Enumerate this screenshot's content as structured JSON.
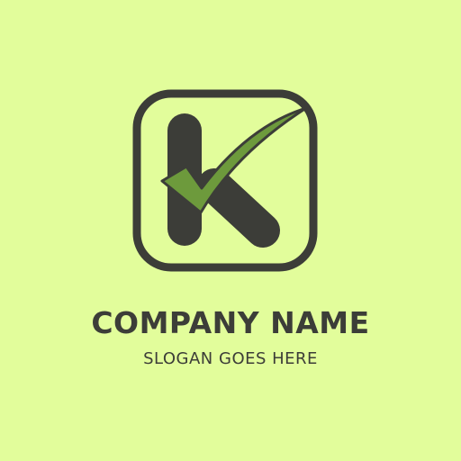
{
  "brand": {
    "name": "COMPANY NAME",
    "slogan": "SLOGAN GOES HERE"
  },
  "logo": {
    "icon": "letter-k-with-checkmark-icon",
    "letter": "K"
  },
  "colors": {
    "background": "#e2fd9b",
    "primary_dark": "#3c3d38",
    "accent_green": "#6d9a3c",
    "accent_outline": "#3c3d38"
  }
}
